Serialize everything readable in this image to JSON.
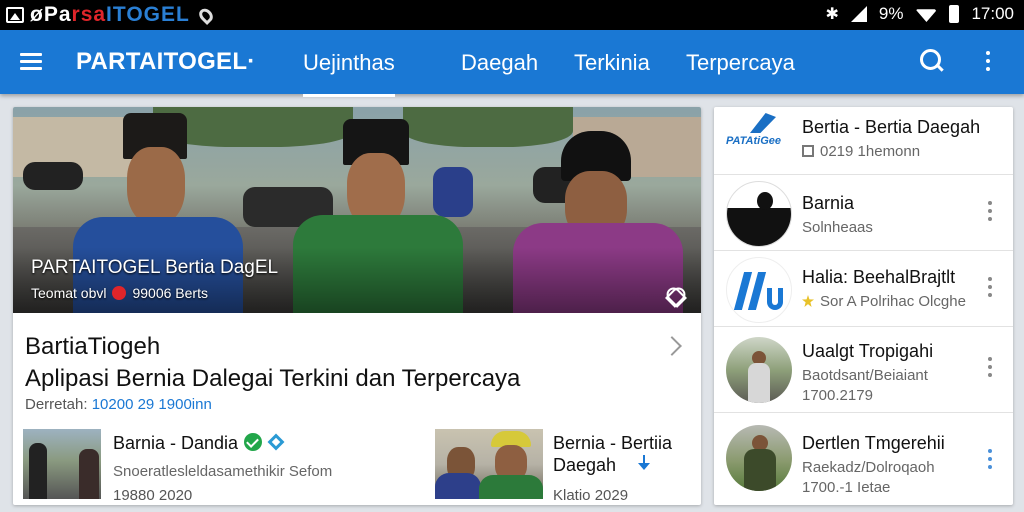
{
  "status_bar": {
    "logo_part1": "øPa",
    "logo_part2": "rsa",
    "logo_part3": "ITOGEL",
    "battery": "9%",
    "time": "17:00"
  },
  "app_bar": {
    "brand": "PARTAITOGEL·",
    "tabs": [
      {
        "label": "Uejinthas"
      },
      {
        "label": "Daegah"
      },
      {
        "label": "Terkinia"
      },
      {
        "label": "Terpercaya"
      }
    ]
  },
  "hero": {
    "title": "PARTAITOGEL Bertia DagEL",
    "meta_left": "Teomat obvl",
    "meta_right": "99006 Berts"
  },
  "article": {
    "category": "BartiaTiogeh",
    "title": "Aplipasi Bernia Dalegai Terkini dan Terpercaya",
    "date_label": "Derretah:",
    "date_value": "10200 29 1900inn"
  },
  "sub_articles": [
    {
      "title": "Barnia - Dandia",
      "desc": "Snoeratlesleldasamethikir Sefom",
      "date": "19880 2020"
    },
    {
      "title_line1": "Bernia - Bertiia",
      "title_line2": "Daegah",
      "date": "Klatio 2029"
    }
  ],
  "side_items": [
    {
      "title": "Bertia - Bertia Daegah",
      "sub": "0219 1hemonn",
      "logo": "PATAtiGee"
    },
    {
      "title": "Barnia",
      "sub": "Solnheaas"
    },
    {
      "title": "Halia: BeehalBrajtlt",
      "sub": "Sor A Polrihac Olcghe"
    },
    {
      "title": "Uaalgt Tropigahi",
      "sub": "Baotdsant/Beiaiant",
      "sub2": "1700.2179"
    },
    {
      "title": "Dertlen Tmgerehii",
      "sub": "Raekadz/Dolroqaoh",
      "sub2": "1700.-1 Ietae"
    }
  ]
}
